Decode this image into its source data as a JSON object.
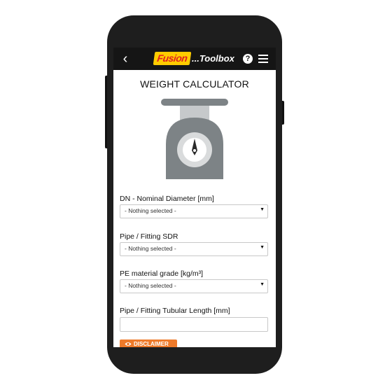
{
  "header": {
    "logo_text": "Fusion",
    "title": "...Toolbox",
    "help_glyph": "?",
    "back_icon": "chevron-left-icon",
    "menu_icon": "hamburger-menu-icon"
  },
  "page": {
    "title": "WEIGHT CALCULATOR",
    "illustration": "weighing-scale-icon"
  },
  "form": {
    "fields": [
      {
        "label": "DN - Nominal Diameter [mm]",
        "value": "- Nothing selected -"
      },
      {
        "label": "Pipe / Fitting SDR",
        "value": "- Nothing selected -"
      },
      {
        "label": "PE material grade [kg/m³]",
        "value": "- Nothing selected -"
      }
    ],
    "length_label": "Pipe / Fitting Tubular Length [mm]",
    "length_value": ""
  },
  "disclaimer": {
    "label": "DISCLAIMER",
    "icon": "eye-icon"
  },
  "colors": {
    "appbar": "#151515",
    "accent": "#ee7a2a",
    "logo_bg": "#ffcc00",
    "logo_text": "#e02020",
    "scale_body": "#7d8386"
  }
}
